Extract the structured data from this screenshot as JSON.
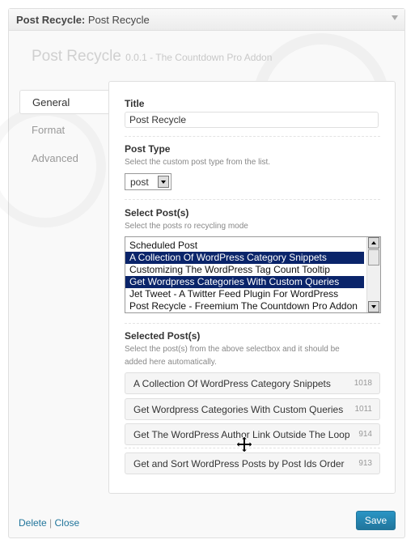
{
  "widget": {
    "title_prefix": "Post Recycle:",
    "title_name": "Post Recycle"
  },
  "addon": {
    "name": "Post Recycle",
    "version_text": "0.0.1 - The Countdown Pro Addon"
  },
  "tabs": [
    {
      "label": "General",
      "active": true
    },
    {
      "label": "Format",
      "active": false
    },
    {
      "label": "Advanced",
      "active": false
    }
  ],
  "title_field": {
    "label": "Title",
    "value": "Post Recycle"
  },
  "post_type": {
    "label": "Post Type",
    "description": "Select the custom post type from the list.",
    "selected": "post"
  },
  "select_posts": {
    "label": "Select Post(s)",
    "description": "Select the posts ro recycling mode",
    "options": [
      {
        "text": "Scheduled Post",
        "selected": false
      },
      {
        "text": "A Collection Of WordPress Category Snippets",
        "selected": true
      },
      {
        "text": "Customizing The WordPress Tag Count Tooltip",
        "selected": false
      },
      {
        "text": "Get Wordpress Categories With Custom Queries",
        "selected": true
      },
      {
        "text": "Jet Tweet - A Twitter Feed Plugin For WordPress",
        "selected": false
      },
      {
        "text": "Post Recycle - Freemium The Countdown Pro Addon",
        "selected": false
      }
    ]
  },
  "selected_posts": {
    "label": "Selected Post(s)",
    "description_line1": "Select the post(s) from the above selectbox and it should be",
    "description_line2": "added here automatically.",
    "items": [
      {
        "name": "A Collection Of WordPress Category Snippets",
        "count": "1018"
      },
      {
        "name": "Get Wordpress Categories With Custom Queries",
        "count": "1011"
      },
      {
        "name": "Get The WordPress Author Link Outside The Loop",
        "count": "914"
      },
      {
        "name": "Get and Sort WordPress Posts by Post Ids Order",
        "count": "913"
      }
    ]
  },
  "footer": {
    "delete_label": "Delete",
    "separator": "|",
    "close_label": "Close",
    "save_label": "Save"
  },
  "colors": {
    "accent": "#21759b",
    "selected_row": "#0a246a"
  }
}
